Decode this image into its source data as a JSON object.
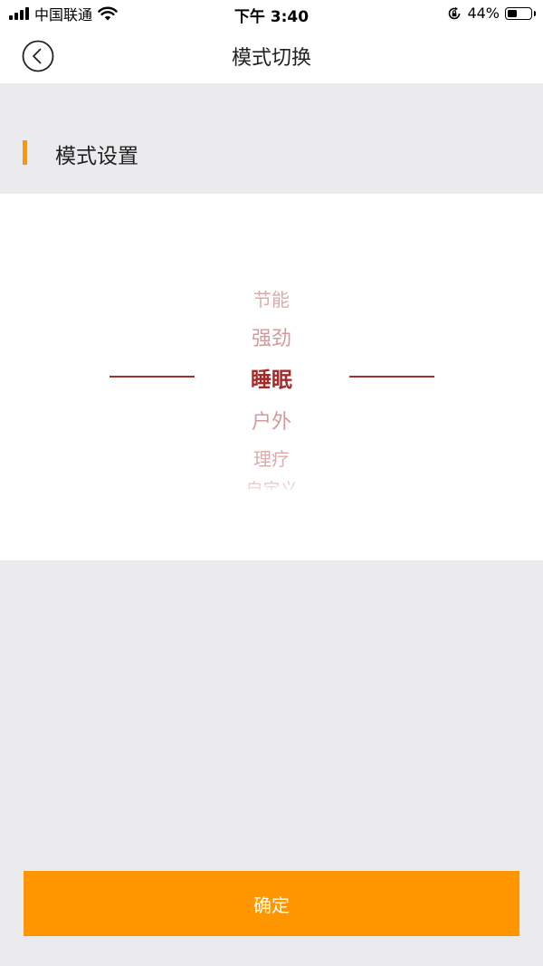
{
  "status_bar": {
    "carrier": "中国联通",
    "time": "下午 3:40",
    "battery_percent": "44%",
    "battery_level": 0.44,
    "icons": [
      "signal-icon",
      "wifi-icon",
      "orientation-lock-icon",
      "battery-icon"
    ]
  },
  "nav": {
    "title": "模式切换",
    "back_icon": "chevron-left-circle-icon"
  },
  "section": {
    "title": "模式设置",
    "accent_color": "#ff9600"
  },
  "picker": {
    "options": [
      "节能",
      "强劲",
      "睡眠",
      "户外",
      "理疗",
      "自定义"
    ],
    "selected": "睡眠",
    "selected_color": "#a52a2a",
    "option_color": "#c98a8a"
  },
  "confirm": {
    "label": "确定",
    "color": "#ff9600"
  }
}
